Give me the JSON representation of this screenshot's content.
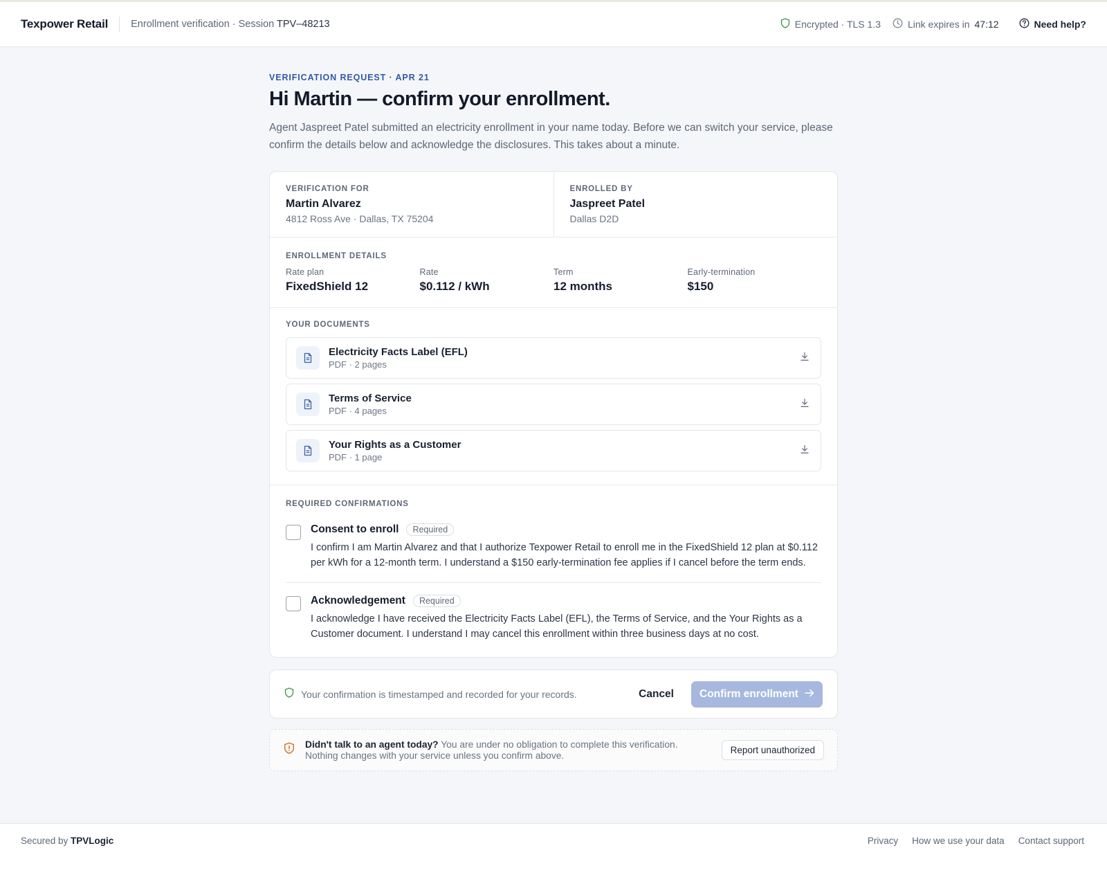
{
  "header": {
    "brand": "Texpower Retail",
    "subtitle_prefix": "Enrollment verification · Session",
    "session_id": "TPV–48213",
    "security": "Encrypted · TLS 1.3",
    "expires_label": "Link expires in",
    "expires_time": "47:12",
    "help": "Need help?"
  },
  "hero": {
    "eyebrow": "VERIFICATION REQUEST · APR 21",
    "title": "Hi Martin — confirm your enrollment.",
    "intro": "Agent Jaspreet Patel submitted an electricity enrollment in your name today. Before we can switch your service, please confirm the details below and acknowledge the disclosures. This takes about a minute."
  },
  "verification_for": {
    "label": "VERIFICATION FOR",
    "name": "Martin Alvarez",
    "address": "4812 Ross Ave · Dallas, TX 75204"
  },
  "enrolled_by": {
    "label": "ENROLLED BY",
    "name": "Jaspreet Patel",
    "team": "Dallas D2D"
  },
  "details": {
    "label": "ENROLLMENT DETAILS",
    "items": [
      {
        "label": "Rate plan",
        "value": "FixedShield 12"
      },
      {
        "label": "Rate",
        "value": "$0.112 / kWh"
      },
      {
        "label": "Term",
        "value": "12 months"
      },
      {
        "label": "Early-termination",
        "value": "$150"
      }
    ]
  },
  "documents": {
    "label": "YOUR DOCUMENTS",
    "items": [
      {
        "title": "Electricity Facts Label (EFL)",
        "meta": "PDF · 2 pages",
        "icon": "document-icon"
      },
      {
        "title": "Terms of Service",
        "meta": "PDF · 4 pages",
        "icon": "document-icon"
      },
      {
        "title": "Your Rights as a Customer",
        "meta": "PDF · 1 page",
        "icon": "document-icon"
      }
    ]
  },
  "confirmations": {
    "label": "REQUIRED CONFIRMATIONS",
    "items": [
      {
        "title": "Consent to enroll",
        "badge": "Required",
        "text": "I confirm I am Martin Alvarez and that I authorize Texpower Retail to enroll me in the FixedShield 12 plan at $0.112 per kWh for a 12-month term. I understand a $150 early-termination fee applies if I cancel before the term ends.",
        "checked": false
      },
      {
        "title": "Acknowledgement",
        "badge": "Required",
        "text": "I acknowledge I have received the Electricity Facts Label (EFL), the Terms of Service, and the Your Rights as a Customer document. I understand I may cancel this enrollment within three business days at no cost.",
        "checked": false
      }
    ]
  },
  "actions": {
    "note": "Your confirmation is timestamped and recorded for your records.",
    "cancel": "Cancel",
    "confirm": "Confirm enrollment",
    "confirm_color": "#a7b8df"
  },
  "warning": {
    "lead": "Didn't talk to an agent today?",
    "text": " You are under no obligation to complete this verification.",
    "text2": "Nothing changes with your service unless you confirm above.",
    "button": "Report unauthorized"
  },
  "footer": {
    "secured_prefix": "Secured by ",
    "secured_brand": "TPVLogic",
    "links": [
      "Privacy",
      "How we use your data",
      "Contact support"
    ]
  },
  "colors": {
    "accent": "#2f5aa6",
    "shield_green": "#3f9a4f",
    "warning_orange": "#d4772c"
  }
}
